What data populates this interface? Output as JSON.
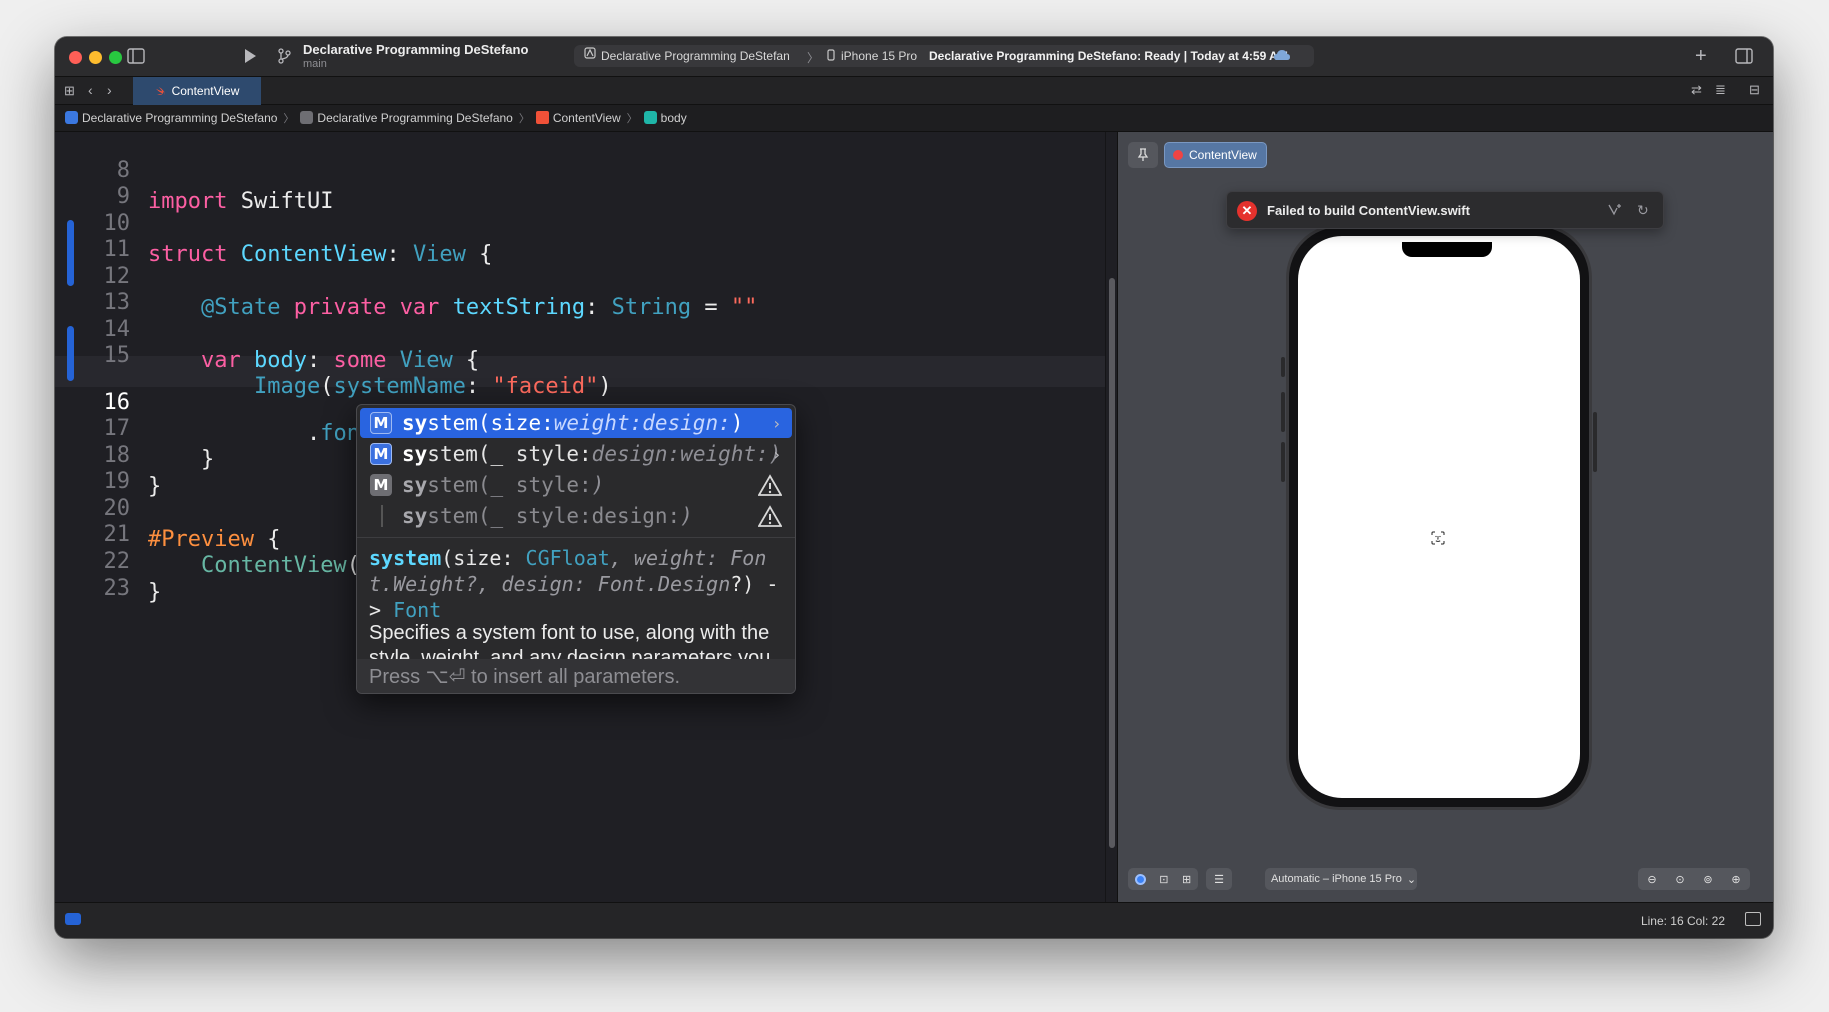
{
  "toolbar": {
    "project_title": "Declarative Programming DeStefano",
    "branch": "main",
    "scheme": "Declarative Programming DeStefan",
    "device": "iPhone 15 Pro",
    "status_project": "Declarative Programming DeStefano:",
    "status_state": "Ready",
    "status_time": "| Today at 4:59 AM"
  },
  "tabs": [
    {
      "label": "ContentView",
      "active": true
    }
  ],
  "breadcrumb": [
    "Declarative Programming DeStefano",
    "Declarative Programming DeStefano",
    "ContentView",
    "body"
  ],
  "editor": {
    "current_line": 16,
    "line_numbers": [
      "8",
      "9",
      "10",
      "11",
      "12",
      "13",
      "14",
      "15",
      "16",
      "17",
      "18",
      "19",
      "20",
      "21",
      "22",
      "23"
    ],
    "lines": [
      "import SwiftUI",
      "",
      "struct ContentView: View {",
      "",
      "    @State private var textString: String = \"\"",
      "",
      "    var body: some View {",
      "        Image(systemName: \"faceid\")",
      "            .font(.sy)",
      "    }",
      "}",
      "",
      "#Preview {",
      "    ContentView()",
      "}",
      ""
    ]
  },
  "completion": {
    "items": [
      {
        "match": "sy",
        "rest": "stem(size:",
        "placeholder": "weight:design:",
        "close": ")",
        "badge": "M",
        "badge_style": "blue",
        "trailing": "chevron"
      },
      {
        "match": "sy",
        "rest": "stem(_ style:",
        "placeholder": "design:weight:",
        "close": ")",
        "badge": "M",
        "badge_style": "blue",
        "trailing": "chevron"
      },
      {
        "match": "sy",
        "rest": "stem(_ style:",
        "placeholder": "",
        "close": ")",
        "badge": "M",
        "badge_style": "gray",
        "trailing": "warning"
      },
      {
        "match": "sy",
        "rest": "stem(_ style:design:",
        "placeholder": "",
        "close": ")",
        "badge": "",
        "badge_style": "none",
        "trailing": "warning"
      }
    ],
    "signature": {
      "name": "system",
      "p1": "(size: ",
      "t1": "CGFloat",
      "p2": ", weight: ",
      "t2": "Font.Weight",
      "p3": "?, design: ",
      "t3": "Font.Design",
      "p4": "?) -> ",
      "t4": "Font"
    },
    "description": "Specifies a system font to use, along with the style, weight, and any design parameters you want applied to the text.",
    "footer": "Press ⌥⏎ to insert all parameters."
  },
  "canvas": {
    "tab_label": "ContentView",
    "error": "Failed to build ContentView.swift",
    "device_selector": "Automatic – iPhone 15 Pro"
  },
  "statusbar": {
    "position": "Line: 16  Col: 22"
  },
  "colors": {
    "keyword": "#fc5fa3",
    "type": "#5dd8ff",
    "string": "#fc6a5d",
    "selection": "#2964e0",
    "error": "#e5322d"
  }
}
